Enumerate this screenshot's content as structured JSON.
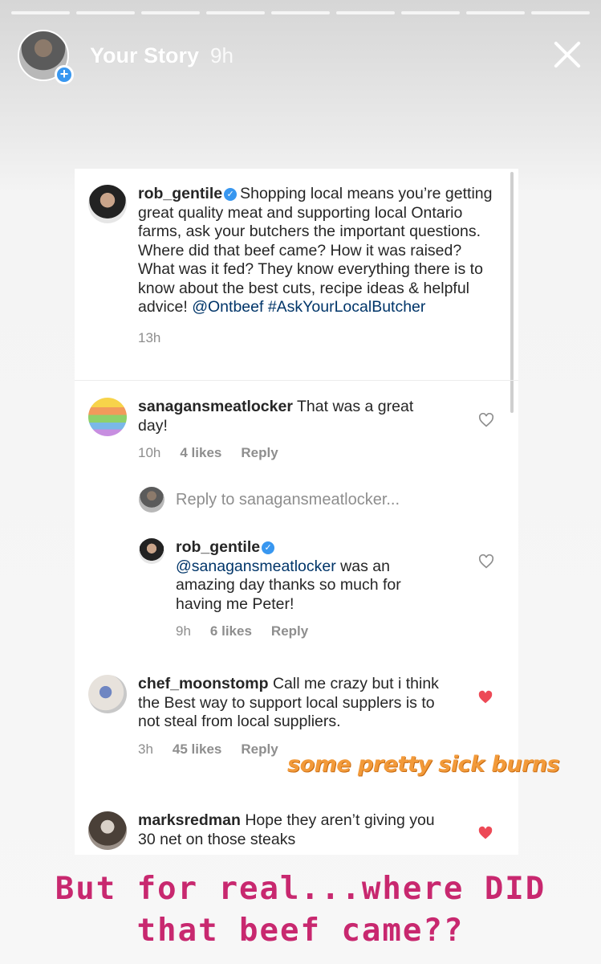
{
  "story": {
    "username": "Your Story",
    "time": "9h",
    "progress_segments": 9
  },
  "post": {
    "username": "rob_gentile",
    "text": "Shopping local means you’re getting great quality meat and supporting local Ontario farms, ask your butchers the important questions. Where did that beef came? How it was raised? What was it fed? They know everything there is to know about the best cuts, recipe ideas & helpful advice!",
    "mention": "@Ontbeef",
    "hashtag": "#AskYourLocalButcher",
    "time": "13h"
  },
  "comments": [
    {
      "username": "sanagansmeatlocker",
      "text": "That was a great day!",
      "time": "10h",
      "likes": "4 likes",
      "reply": "Reply",
      "liked": false
    },
    {
      "username": "rob_gentile",
      "mention": "@sanagansmeatlocker",
      "text": "was an amazing day thanks so much for having me Peter!",
      "time": "9h",
      "likes": "6 likes",
      "reply": "Reply",
      "liked": false
    },
    {
      "username": "chef_moonstomp",
      "text": "Call me crazy but i think the Best way to support local supplers is to not steal from local suppliers.",
      "time": "3h",
      "likes": "45 likes",
      "reply": "Reply",
      "liked": true
    },
    {
      "username": "marksredman",
      "text": "Hope they aren’t giving you 30 net on those steaks",
      "liked": true
    }
  ],
  "reply_to": "Reply to sanagansmeatlocker...",
  "sticker": "some pretty sick burns",
  "caption": {
    "line1": "But for real...where DID",
    "line2": "that beef came??"
  },
  "colors": {
    "like_red": "#ed4956",
    "mention_blue": "#003569",
    "verified_blue": "#3897f0",
    "caption_pink": "#c8286f",
    "sticker_orange": "#f29a3a"
  }
}
